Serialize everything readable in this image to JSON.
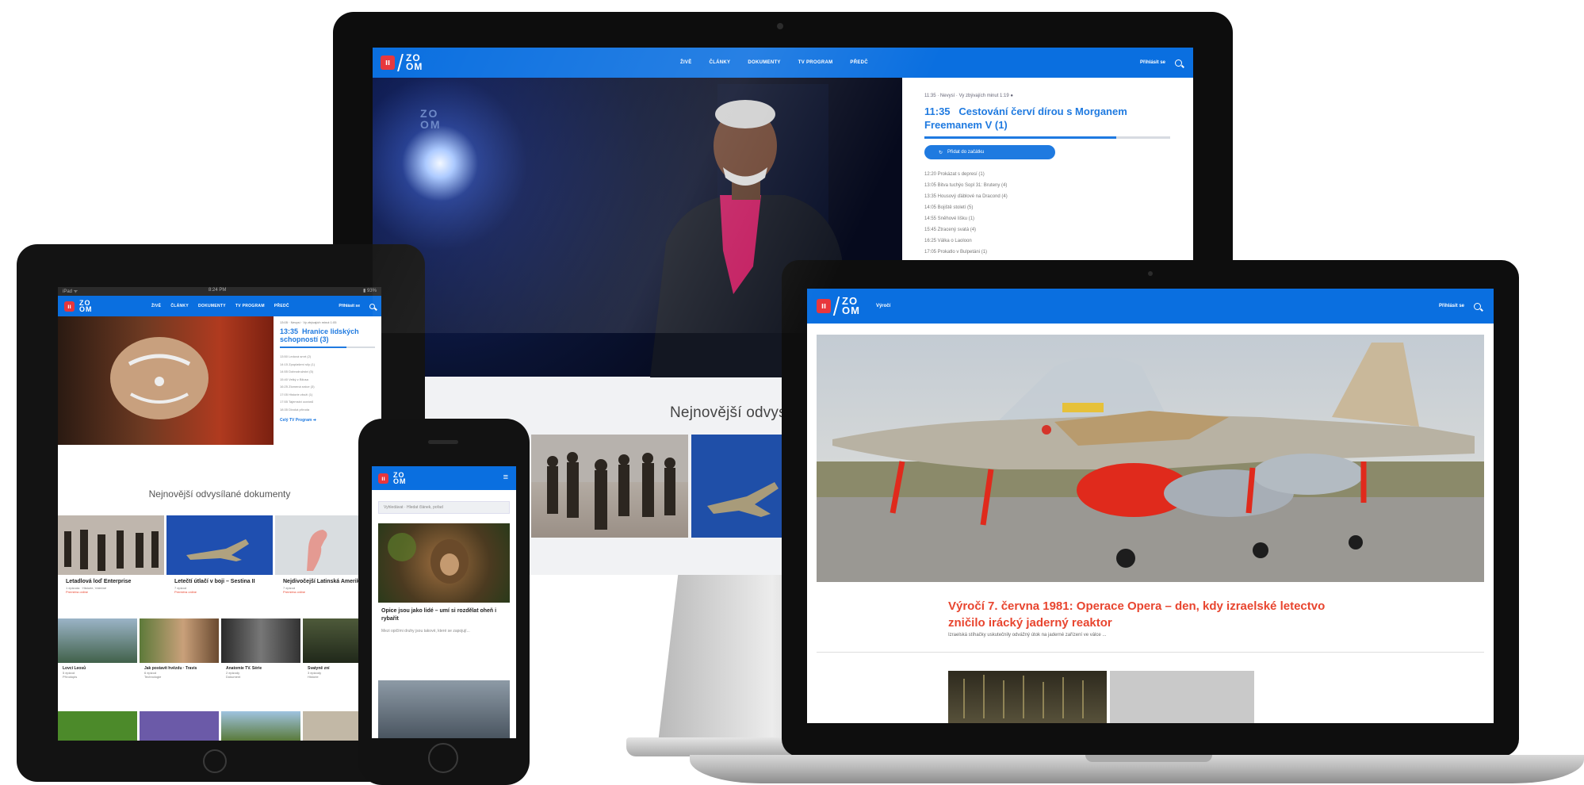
{
  "brand": {
    "logo_text_top": "ZO",
    "logo_text_bottom": "OM",
    "logo_mark": "ıı",
    "accent": "#0a6fe0",
    "highlight": "#e8452f"
  },
  "imac": {
    "nav": {
      "items": [
        "ŽIVĚ",
        "ČLÁNKY",
        "DOKUMENTY",
        "TV PROGRAM",
        "PŘEDČ"
      ],
      "login_label": "Přihlásit se"
    },
    "hero_logo_top": "ZO",
    "hero_logo_bottom": "OM",
    "schedule": {
      "now_small": "11:35 · Nevysí · Vy zbývajích minut 1:19 ●",
      "now_time": "11:35",
      "now_title": "Cestování červí dírou s Morganem Freemanem V (1)",
      "button_label": "Přidat do začátku",
      "progress": 0.78,
      "rows": [
        "12:20  Prokázat s depresí (1)",
        "13:05  Bitva tuchýo Sopl 31: Bruteny (4)",
        "13:35  Housový ďáblové na Dracond (4)",
        "14:05  Bojiště století (5)",
        "14:55  Sněhové lišku (1)",
        "15:45  Ztracený svatá (4)",
        "16:25  Válka o Laoloon",
        "17:05  Prokatlo v Bulpetáni (1)"
      ]
    },
    "section_title": "Nejnovější odvys"
  },
  "ipad": {
    "status_left": "iPad ᯤ",
    "status_center": "8:24 PM",
    "status_right": "▮ 93%",
    "nav": {
      "items": [
        "ŽIVĚ",
        "ČLÁNKY",
        "DOKUMENTY",
        "TV PROGRAM",
        "PŘEDČ"
      ],
      "login_label": "Přihlásit se"
    },
    "schedule": {
      "now_small": "13:05 · Nevysí · Vy zbývajích minut 1:05",
      "now_time": "13:35",
      "now_title": "Hranice lidských schopností (3)",
      "rows": [
        "13:50  Ledová smrt (2)",
        "14:15  Zpoplašení síly (1)",
        "14:55  Dobrodružství (5)",
        "15:40  Velký z Bilusa",
        "16:25  Zlomená srdce (3)",
        "17:05  Historie zboží (1)",
        "17:55  Tajemství oceánů",
        "18:35  Divoká příroda"
      ],
      "link_label": "Celý TV Program"
    },
    "section_title": "Nejnovější odvysílané dokumenty",
    "cards_row1": [
      {
        "title": "Letadlová loď Enterprise",
        "meta": "1 epizoda · Historie, Válečné",
        "badge": "Premiéra online"
      },
      {
        "title": "Letečtí útlačí v boji – Sestina II",
        "meta": "7 epizod",
        "badge": "Premiéra online"
      },
      {
        "title": "Nejdivočejší Latinská Amerika",
        "meta": "7 epizod",
        "badge": "Premiéra online"
      }
    ],
    "cards_row2": [
      {
        "title": "Lovci Leosů",
        "meta": "5 epizod",
        "badge": "Přírodopis"
      },
      {
        "title": "Jak postavit hvězdu · Travis",
        "meta": "6 epizod",
        "badge": "Technologie"
      },
      {
        "title": "Anatomie TV. Série",
        "meta": "2 epizody",
        "badge": "Dokument"
      },
      {
        "title": "Svatyně zní",
        "meta": "3 epizody",
        "badge": "Historie"
      }
    ]
  },
  "iphone": {
    "search_placeholder": "Vyhledávat · Hledat článek, pořad",
    "article_title": "Opice jsou jako lidé – umí si rozdělat oheň i rybařit",
    "article_text": "Mezi opičími druhy jsou takové, které se zapojují...",
    "menu_icon": "≡"
  },
  "laptop": {
    "nav": {
      "label": "Výročí",
      "login_label": "Přihlásit se"
    },
    "article": {
      "title": "Výročí 7. června 1981: Operace Opera – den, kdy izraelské letectvo zničilo irácký jaderný reaktor",
      "subtitle": "Izraelská stíhačky uskutečnily odvážný útok na jaderné zařízení ve válce ..."
    }
  }
}
